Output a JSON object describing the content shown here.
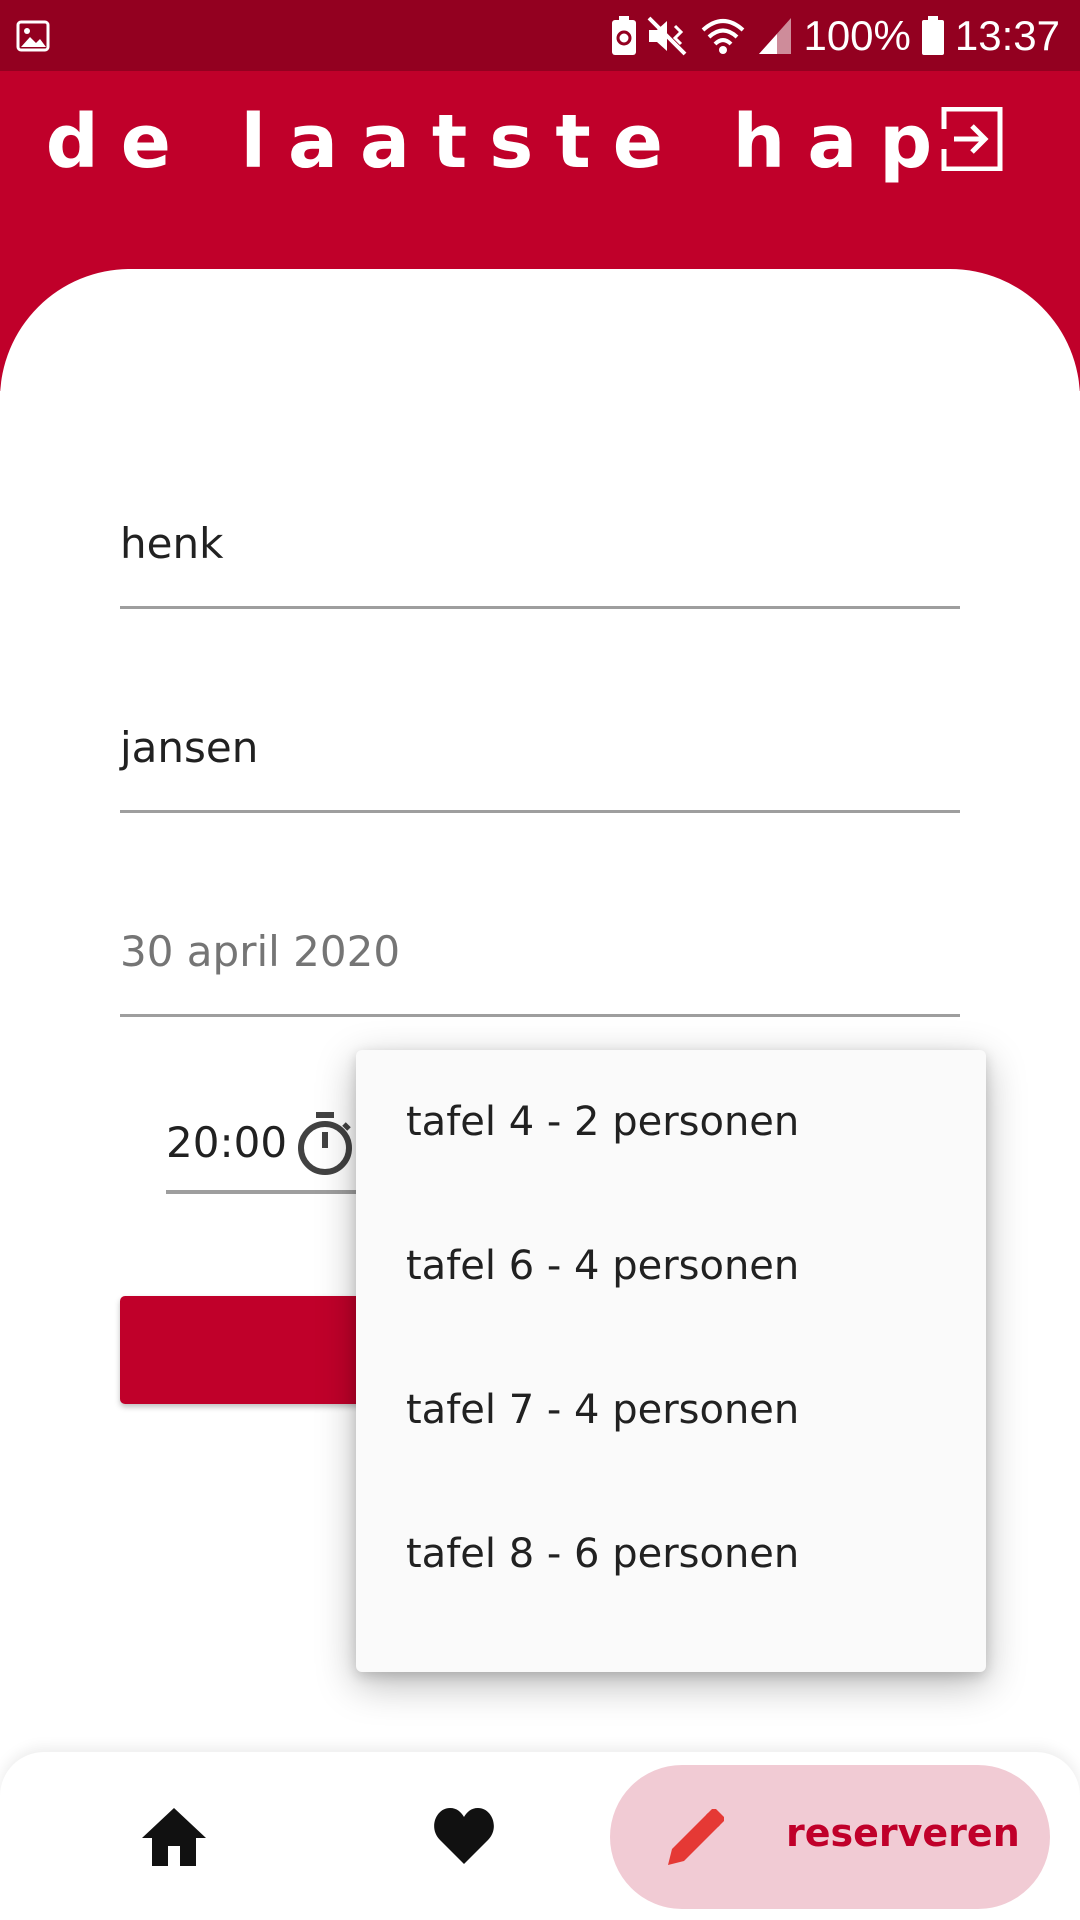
{
  "status_bar": {
    "battery_percent": "100%",
    "time": "13:37",
    "icons": [
      "image-icon",
      "battery-saver-icon",
      "mute-vibrate-icon",
      "wifi-icon",
      "signal-icon",
      "battery-icon"
    ]
  },
  "header": {
    "title": "de laatste hap",
    "logout_icon": "exit-to-app-icon"
  },
  "form": {
    "first_name": "henk",
    "last_name": "jansen",
    "date": "30 april 2020",
    "time": "20:00",
    "time_icon": "timer-icon"
  },
  "dropdown": {
    "items": [
      "tafel 4 - 2 personen",
      "tafel 6 - 4 personen",
      "tafel 7 - 4 personen",
      "tafel 8 - 6 personen"
    ]
  },
  "bottom_nav": {
    "home_icon": "home-icon",
    "favorites_icon": "heart-icon",
    "reserve_icon": "pencil-icon",
    "reserve_label": "reserveren"
  },
  "colors": {
    "status_bar": "#930020",
    "primary": "#c0002a",
    "nav_active_bg": "#f1cbd4",
    "pencil": "#e53935"
  }
}
